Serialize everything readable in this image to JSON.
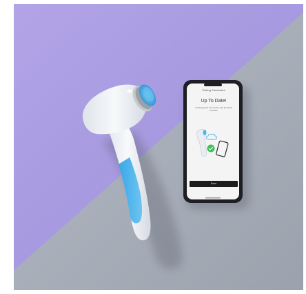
{
  "phone_screen": {
    "status_text": "Pairing Successful",
    "title": "Up To Date!",
    "subtitle": "Looking good! Your device has the latest firmware",
    "button_label": "Done"
  },
  "colors": {
    "purple_backdrop": "#a99be0",
    "gray_backdrop": "#a7aeb9",
    "device_white": "#eef1f5",
    "device_blue": "#4fb4ec",
    "phone_body": "#1d1f24",
    "screen_bg": "#f4f4f4",
    "check_green": "#3fbf57"
  },
  "icons": [
    "device-icon",
    "cloud-sync-icon",
    "check-icon",
    "phone-outline-icon"
  ]
}
